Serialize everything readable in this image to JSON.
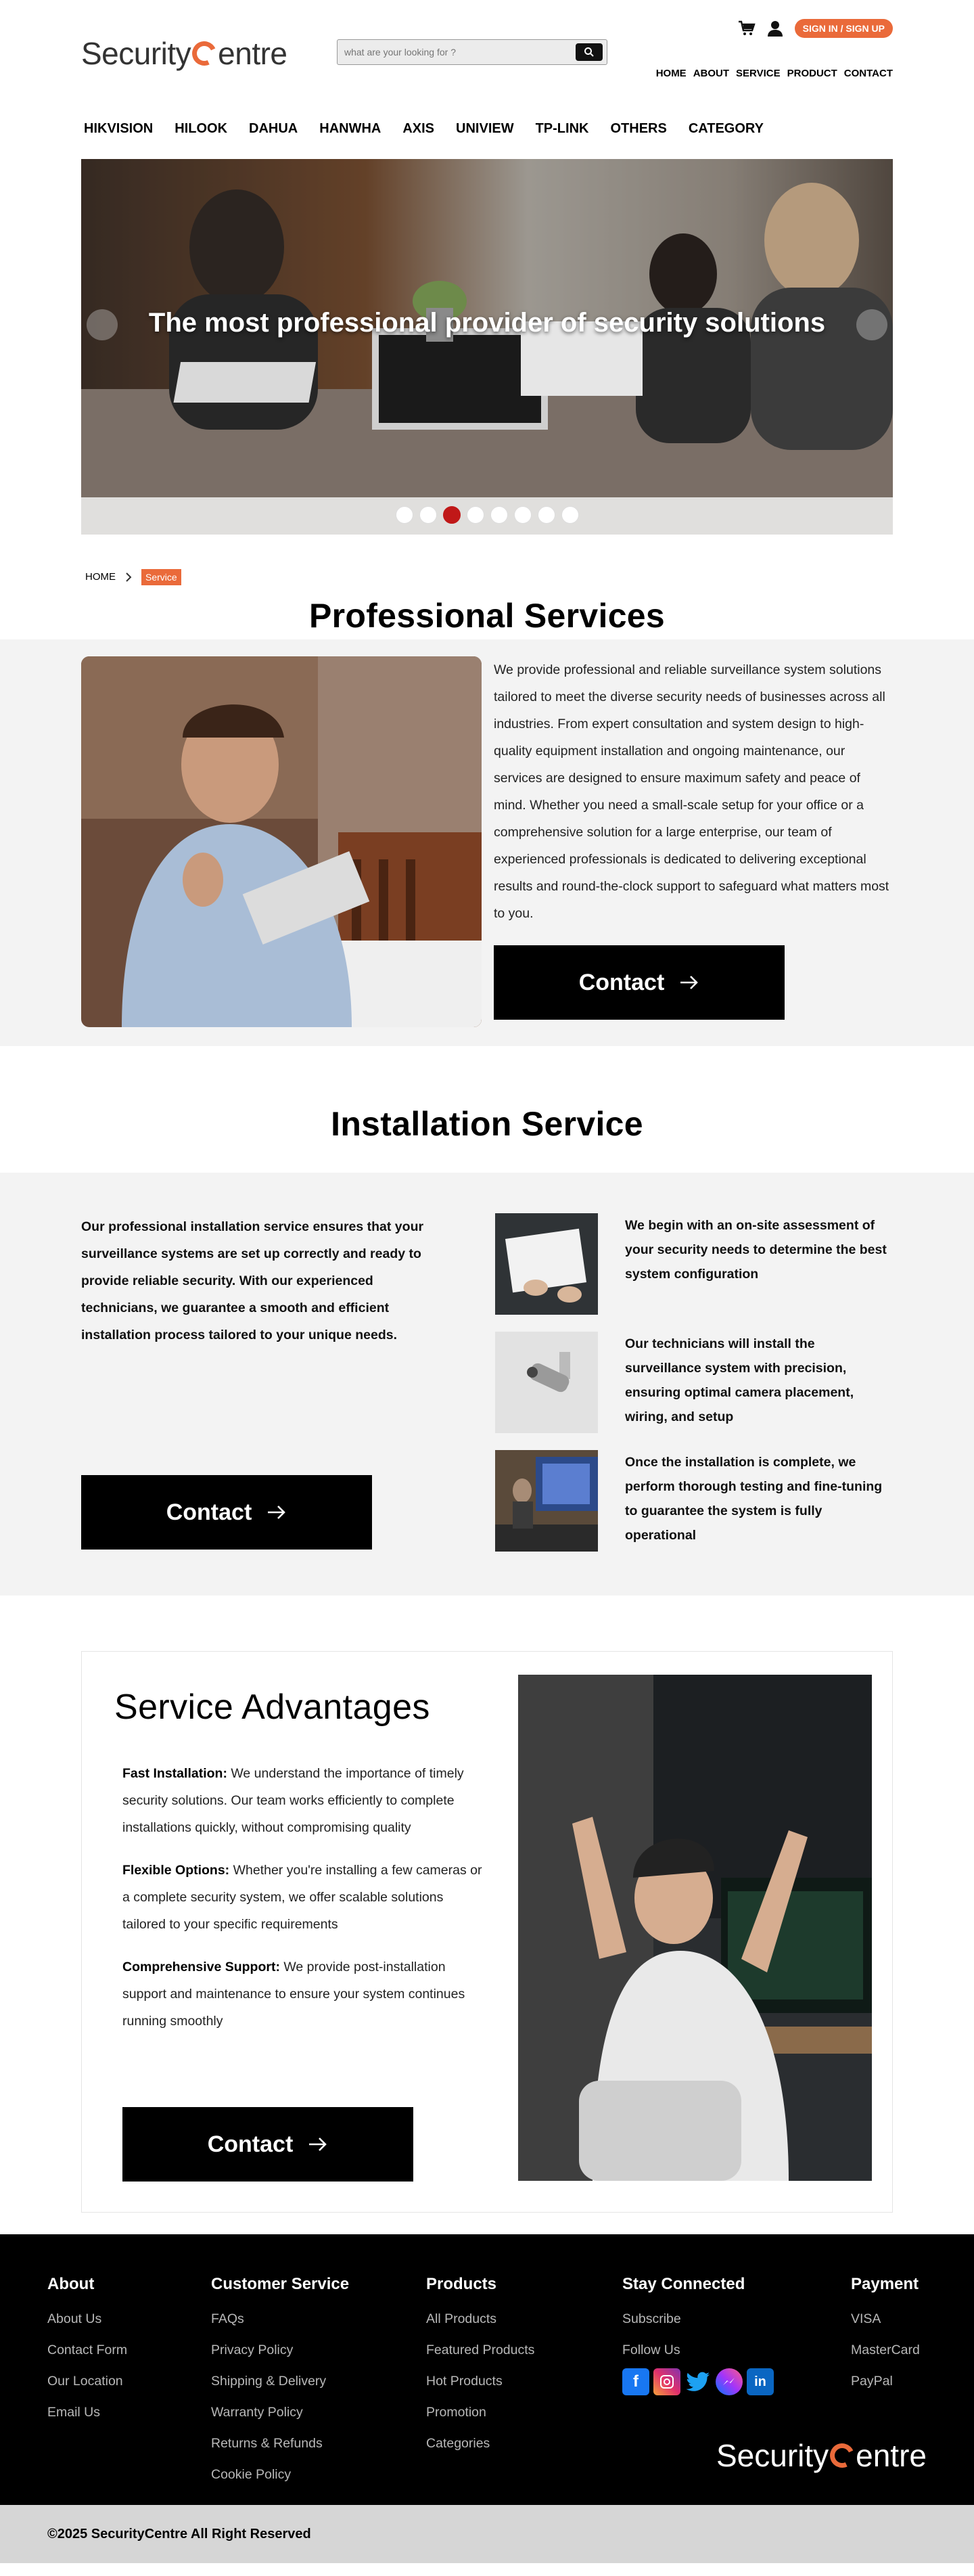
{
  "header": {
    "logo_part1": "Security",
    "logo_part2": "entre",
    "search_placeholder": "what are your looking for ?",
    "signin_label": "SIGN IN / SIGN UP",
    "topnav": [
      "HOME",
      "ABOUT",
      "SERVICE",
      "PRODUCT",
      "CONTACT"
    ]
  },
  "category_nav": [
    "HIKVISION",
    "HILOOK",
    "DAHUA",
    "HANWHA",
    "AXIS",
    "UNIVIEW",
    "TP-LINK",
    "OTHERS",
    "CATEGORY"
  ],
  "hero": {
    "title": "The most professional provider of security solutions",
    "slide_count": 8,
    "active_slide": 3
  },
  "breadcrumb": {
    "home": "HOME",
    "current": "Service"
  },
  "professional": {
    "title": "Professional Services",
    "text": "We provide professional and reliable surveillance system solutions tailored to meet the diverse security needs of businesses across all industries. From expert consultation and system design to high-quality equipment installation and ongoing maintenance, our services are designed to ensure maximum safety and peace of mind. Whether you need a small-scale setup for your office or a comprehensive solution for a large enterprise, our team of experienced professionals is dedicated to delivering exceptional results and round-the-clock support to safeguard what matters most to you.",
    "contact_label": "Contact"
  },
  "installation": {
    "title": "Installation Service",
    "intro": "Our professional installation service ensures that your surveillance systems are set up correctly and ready to provide reliable security. With our experienced technicians, we guarantee a smooth and efficient installation process tailored to your unique needs.",
    "contact_label": "Contact",
    "steps": [
      "We begin with an on-site assessment of your security needs to determine the best system configuration",
      "Our technicians will install the surveillance system with precision, ensuring optimal camera placement, wiring, and setup",
      "Once the installation is complete, we perform thorough testing and fine-tuning to guarantee the system is fully operational"
    ]
  },
  "advantages": {
    "title": "Service Advantages",
    "items": [
      {
        "label": "Fast Installation:",
        "text": " We understand the importance of timely security solutions. Our team works efficiently to complete installations quickly, without compromising quality"
      },
      {
        "label": "Flexible Options:",
        "text": " Whether you're installing a few cameras or a complete security system, we offer scalable solutions tailored to your specific requirements"
      },
      {
        "label": "Comprehensive Support:",
        "text": " We provide post-installation support and maintenance to ensure your system continues running smoothly"
      }
    ],
    "contact_label": "Contact"
  },
  "footer": {
    "about": {
      "title": "About",
      "links": [
        "About Us",
        "Contact Form",
        "Our Location",
        "Email Us"
      ]
    },
    "customer": {
      "title": "Customer Service",
      "links": [
        "FAQs",
        "Privacy Policy",
        "Shipping & Delivery",
        "Warranty Policy",
        "Returns & Refunds",
        "Cookie Policy"
      ]
    },
    "products": {
      "title": "Products",
      "links": [
        "All Products",
        "Featured Products",
        "Hot Products",
        "Promotion",
        "Categories"
      ]
    },
    "connected": {
      "title": "Stay Connected",
      "links": [
        "Subscribe",
        "Follow Us"
      ]
    },
    "payment": {
      "title": "Payment",
      "links": [
        "VISA",
        "MasterCard",
        "PayPal"
      ]
    },
    "social_icons": [
      "facebook-icon",
      "instagram-icon",
      "twitter-icon",
      "messenger-icon",
      "linkedin-icon"
    ],
    "copyright": "©2025 SecurityCentre All Right Reserved"
  },
  "colors": {
    "accent": "#ea6a3a",
    "active_dot": "#c01818",
    "band": "#f3f3f3",
    "footer_bg": "#000000",
    "copy_bg": "#d6d6d6"
  }
}
